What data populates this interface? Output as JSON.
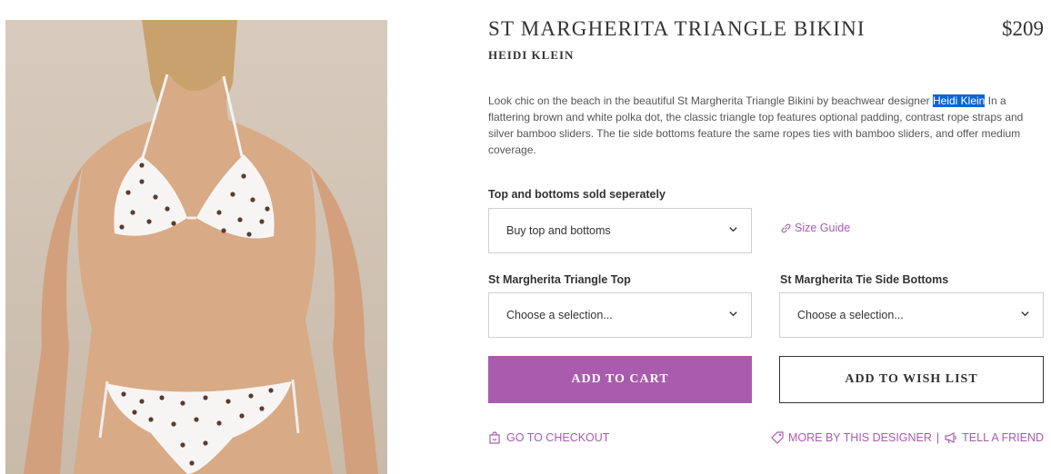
{
  "product": {
    "title": "ST MARGHERITA TRIANGLE BIKINI",
    "price": "$209",
    "brand": "HEIDI KLEIN",
    "description_pre": "Look chic on the beach in the beautiful St Margherita Triangle Bikini by beachwear designer ",
    "description_link": "Heidi Klein",
    "description_post": " In a flattering brown and white polka dot, the classic triangle top features optional padding, contrast rope straps and silver bamboo sliders.  The tie side bottoms feature the same ropes ties with bamboo sliders, and offer medium coverage."
  },
  "options": {
    "purchase_label": "Top and bottoms sold seperately",
    "purchase_value": "Buy top and bottoms",
    "size_guide": "Size Guide",
    "top_label": "St Margherita Triangle Top",
    "top_value": "Choose a selection...",
    "bottoms_label": "St Margherita Tie Side Bottoms",
    "bottoms_value": "Choose a selection..."
  },
  "actions": {
    "add_to_cart": "ADD TO CART",
    "add_to_wishlist": "ADD TO WISH LIST",
    "checkout": "GO TO CHECKOUT",
    "more_by_designer": "MORE BY THIS DESIGNER",
    "separator": "|",
    "tell_friend": "TELL A FRIEND"
  },
  "colors": {
    "accent": "#a95bad",
    "highlight": "#0a64d6"
  }
}
